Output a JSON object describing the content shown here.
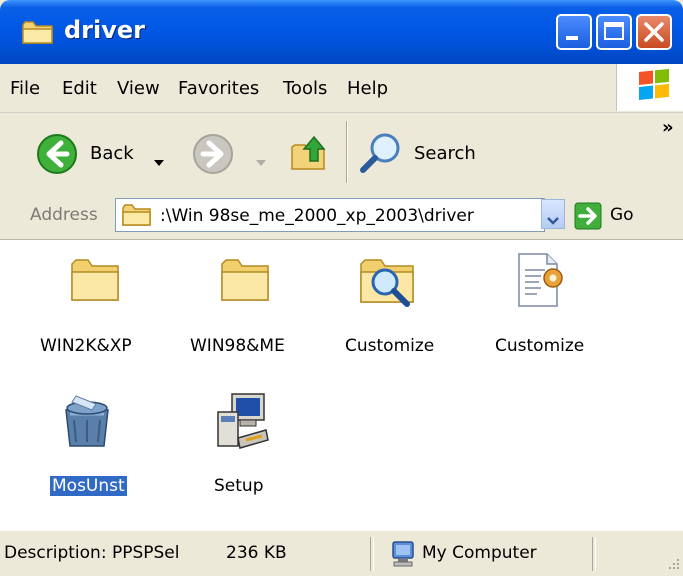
{
  "window": {
    "title": "driver"
  },
  "menu": {
    "items": [
      {
        "label": "File"
      },
      {
        "label": "Edit"
      },
      {
        "label": "View"
      },
      {
        "label": "Favorites"
      },
      {
        "label": "Tools"
      },
      {
        "label": "Help"
      }
    ]
  },
  "toolbar": {
    "back_label": "Back",
    "search_label": "Search",
    "overflow_label": "»"
  },
  "address": {
    "label": "Address",
    "value": ":\\Win 98se_me_2000_xp_2003\\driver",
    "go_label": "Go"
  },
  "files": [
    {
      "name": "WIN2K&XP",
      "icon": "folder-icon"
    },
    {
      "name": "WIN98&ME",
      "icon": "folder-icon"
    },
    {
      "name": "Customize",
      "icon": "folder-search-icon"
    },
    {
      "name": "Customize",
      "icon": "settings-file-icon"
    },
    {
      "name": "MosUnst",
      "icon": "uninstall-icon",
      "selected": true
    },
    {
      "name": "Setup",
      "icon": "setup-computer-icon"
    }
  ],
  "status": {
    "description": "Description: PPSPSel",
    "size": "236 KB",
    "location": "My Computer"
  },
  "colors": {
    "titlebar": "#0058e6",
    "selection": "#316ac5",
    "close_button": "#c94a22"
  }
}
